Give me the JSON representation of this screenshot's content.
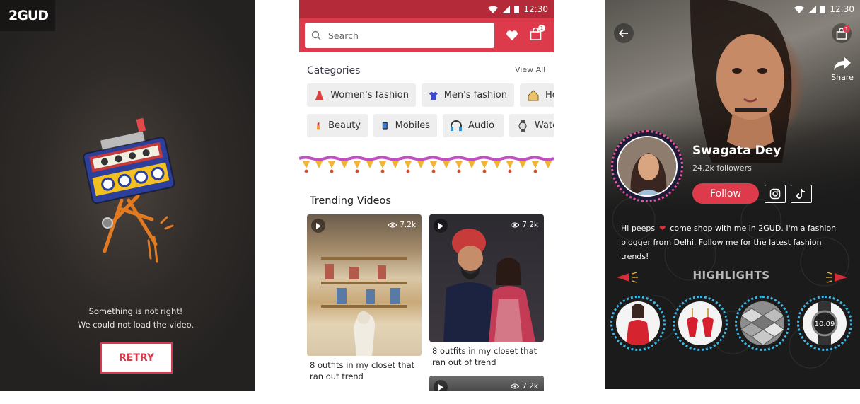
{
  "panel_error": {
    "logo": "2GUD",
    "message_line1": "Something is not right!",
    "message_line2": "We could not load the video.",
    "retry_label": "RETRY"
  },
  "panel_home": {
    "status": {
      "time": "12:30"
    },
    "search": {
      "placeholder": "Search"
    },
    "cart_badge": "1",
    "categories": {
      "title": "Categories",
      "view_all": "View All",
      "row1": [
        {
          "label": "Women's fashion",
          "icon": "dress-icon"
        },
        {
          "label": "Men's fashion",
          "icon": "shirt-icon"
        },
        {
          "label": "Ho",
          "icon": "home-icon"
        }
      ],
      "row2": [
        {
          "label": "Beauty",
          "icon": "lipstick-icon"
        },
        {
          "label": "Mobiles",
          "icon": "phone-icon"
        },
        {
          "label": "Audio",
          "icon": "headphones-icon"
        },
        {
          "label": "Watc",
          "icon": "watch-icon"
        }
      ]
    },
    "trending": {
      "title": "Trending Videos",
      "videos": [
        {
          "views": "7.2k",
          "caption": "8 outfits in my closet that ran out trend"
        },
        {
          "views": "7.2k",
          "caption": "8 outfits in my closet that ran out of trend"
        },
        {
          "views": "7.2k",
          "caption": ""
        }
      ]
    }
  },
  "panel_profile": {
    "status": {
      "time": "12:30"
    },
    "share_label": "Share",
    "cart_badge": "1",
    "name": "Swagata Dey",
    "followers": "24.2k followers",
    "follow_label": "Follow",
    "bio_part1": "Hi peeps",
    "bio_part2": "come shop with me in 2GUD. I'm a fashion blogger from Delhi. Follow me for the latest fashion trends!",
    "highlights_title": "HIGHLIGHTS",
    "watch_time": "10:09",
    "highlights": [
      "red-top",
      "red-earrings",
      "cube-pattern",
      "smartwatch"
    ]
  },
  "colors": {
    "brand_red": "#dd3b4b",
    "status_red": "#b52a38",
    "highlight_ring": "#3bb6e6",
    "avatar_ring": "#e65890"
  }
}
